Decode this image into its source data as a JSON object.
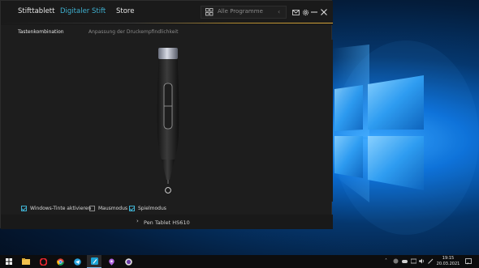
{
  "app": {
    "nav_tabs": [
      "Stifttablett",
      "Digitaler Stift",
      "Store"
    ],
    "active_tab": "Digitaler Stift",
    "programs_label": "Alle Programme",
    "sub_tabs": [
      "Tastenkombination",
      "Anpassung der Druckempfindlichkeit"
    ],
    "options": [
      {
        "label": "Windows-Tinte aktivieren",
        "checked": true
      },
      {
        "label": "Mausmodus",
        "checked": false
      },
      {
        "label": "Spielmodus",
        "checked": true
      }
    ],
    "device_name": "Pen Tablet HS610",
    "accent_color": "#3fb0d0",
    "icons": [
      "grid-icon",
      "chevron-left-icon",
      "mail-icon",
      "gear-icon",
      "minimize-icon",
      "close-icon"
    ]
  },
  "taskbar": {
    "apps": [
      "windows-start",
      "file-explorer",
      "opera",
      "chrome",
      "telegram",
      "pen-tablet-app",
      "maps",
      "obs"
    ],
    "active_app": "pen-tablet-app",
    "clock_time": "19:15",
    "clock_date": "20.03.2021"
  }
}
